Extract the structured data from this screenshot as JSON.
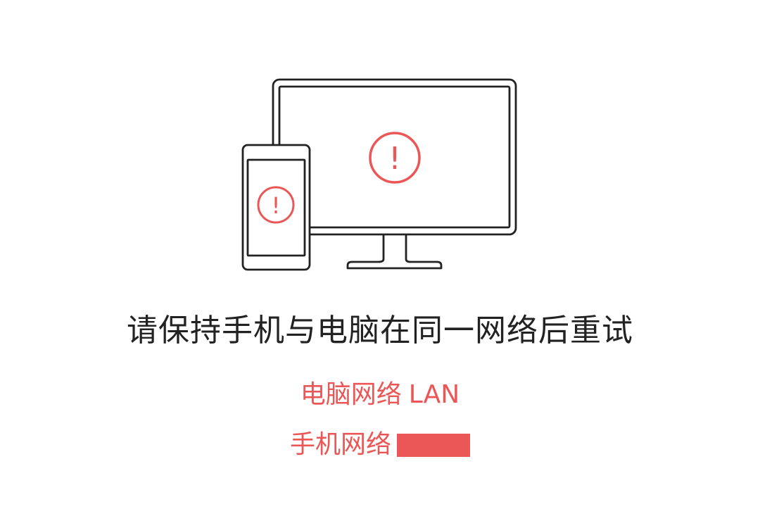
{
  "colors": {
    "accent": "#EB5757",
    "outline": "#222222",
    "text": "#222222",
    "background": "#FFFFFF"
  },
  "illustration": {
    "monitor_icon": "monitor-icon",
    "phone_icon": "phone-icon",
    "alert_icon": "exclamation-circle-icon",
    "alert_glyph": "!"
  },
  "message": {
    "headline": "请保持手机与电脑在同一网络后重试"
  },
  "network": {
    "pc_label": "电脑网络",
    "pc_value": "LAN",
    "phone_label": "手机网络"
  }
}
